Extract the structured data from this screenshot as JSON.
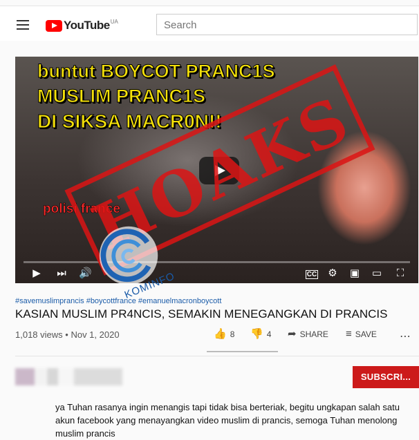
{
  "header": {
    "logo_text": "YouTube",
    "country_code": "UA",
    "search_placeholder": "Search"
  },
  "video": {
    "overlay_title_lines": [
      "buntut BOYCOT PRANC1S",
      "MUSLIM PRANC1S",
      "DI SIKSA MACR0N!!"
    ],
    "overlay_caption": "polisi france",
    "stamp_text": "HOAKS",
    "watermark_text": "KOMINFO"
  },
  "info": {
    "hashtags": "#savemuslimprancis #boycottfrance #emanuelmacronboycott",
    "title": "KASIAN MUSLIM PR4NCIS, SEMAKIN MENEGANGKAN DI PRANCIS",
    "views": "1,018 views",
    "date": "Nov 1, 2020",
    "likes": "8",
    "dislikes": "4",
    "share_label": "SHARE",
    "save_label": "SAVE"
  },
  "channel": {
    "subscribe_label": "SUBSCRI..."
  },
  "description": "ya Tuhan rasanya ingin menangis tapi tidak bisa berteriak, begitu ungkapan salah satu akun facebook yang menayangkan video muslim di prancis, semoga Tuhan menolong muslim prancis"
}
